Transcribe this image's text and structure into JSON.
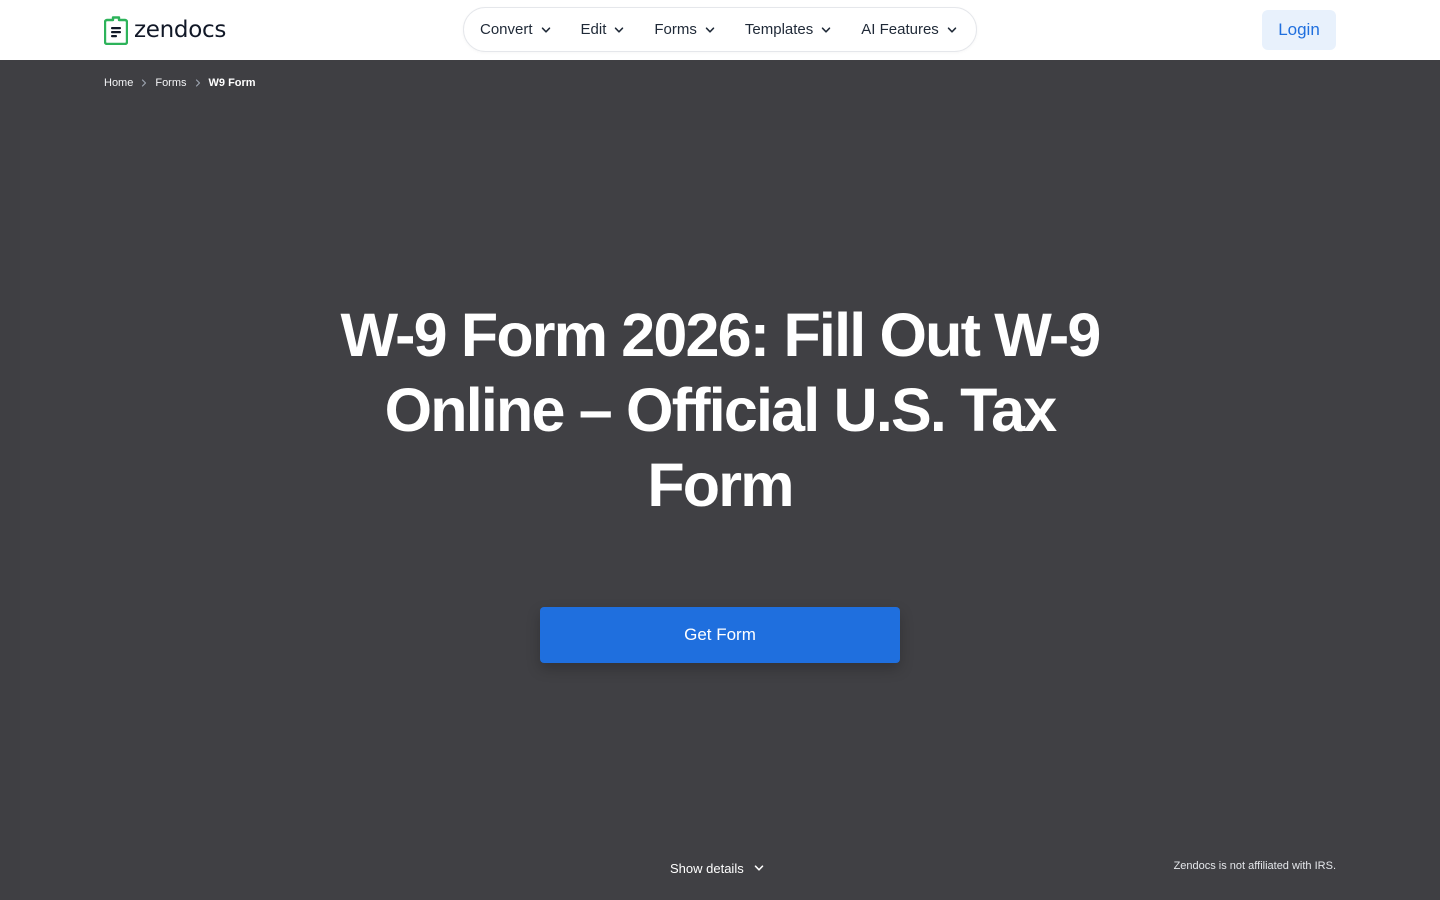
{
  "brand": {
    "name": "zendocs",
    "colors": {
      "accent": "#1f6fde",
      "logo_green": "#2db35a",
      "hero_bg": "#3f3f43"
    }
  },
  "nav": {
    "items": [
      {
        "label": "Convert",
        "icon": "chevron-down-icon"
      },
      {
        "label": "Edit",
        "icon": "chevron-down-icon"
      },
      {
        "label": "Forms",
        "icon": "chevron-down-icon"
      },
      {
        "label": "Templates",
        "icon": "chevron-down-icon"
      },
      {
        "label": "AI Features",
        "icon": "chevron-down-icon"
      }
    ],
    "login_label": "Login"
  },
  "breadcrumb": {
    "items": [
      "Home",
      "Forms",
      "W9 Form"
    ],
    "separator_icon": "chevron-right-icon"
  },
  "hero": {
    "title": "W-9 Form 2026: Fill Out W-9 Online – Official U.S. Tax Form",
    "cta_label": "Get Form",
    "details_label": "Show details",
    "details_icon": "chevron-down-icon",
    "disclaimer": "Zendocs is not affiliated with IRS."
  }
}
